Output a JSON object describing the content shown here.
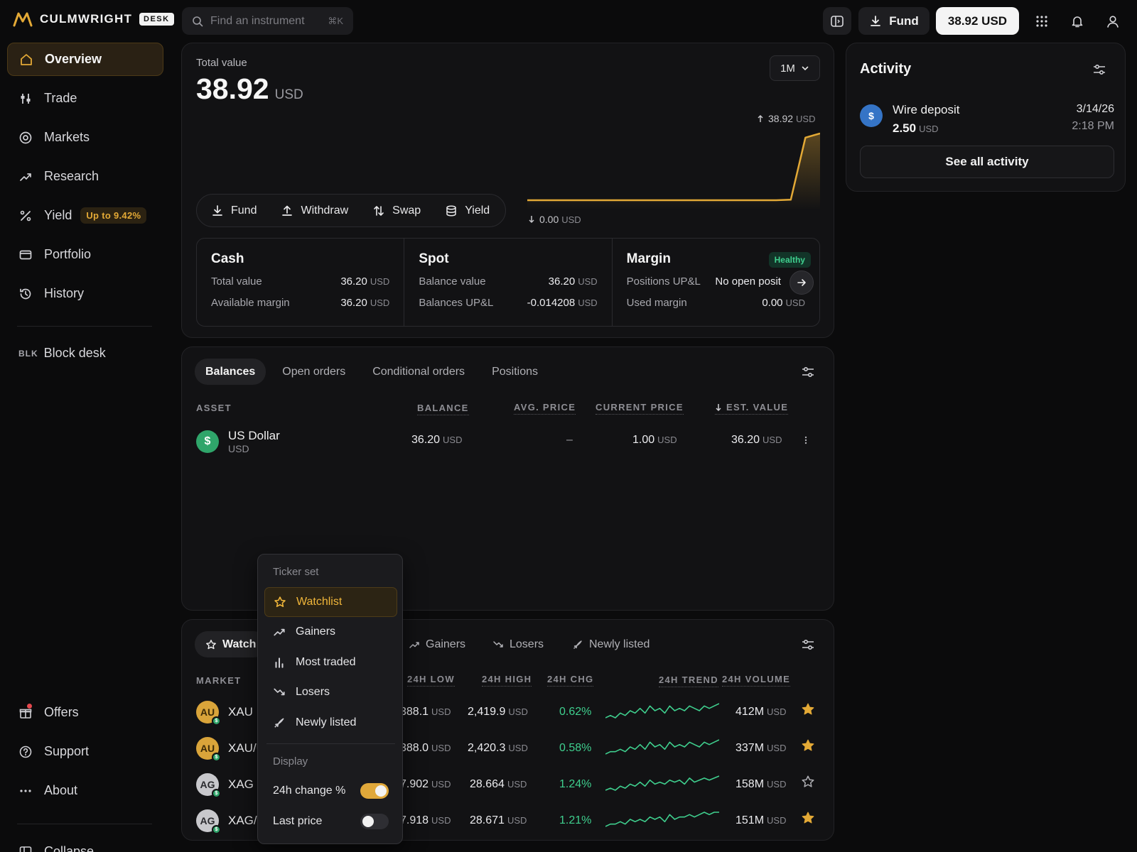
{
  "brand": {
    "name": "CULMWRIGHT",
    "badge": "DESK"
  },
  "header": {
    "search_placeholder": "Find an instrument",
    "search_shortcut": "⌘K",
    "fund_label": "Fund",
    "balance_label": "38.92 USD"
  },
  "sidebar": {
    "items": [
      {
        "label": "Overview",
        "icon": "home-icon",
        "active": true
      },
      {
        "label": "Trade",
        "icon": "sliders-icon"
      },
      {
        "label": "Markets",
        "icon": "target-icon"
      },
      {
        "label": "Research",
        "icon": "trend-up-icon"
      },
      {
        "label": "Yield",
        "icon": "percent-icon",
        "badge": "Up to 9.42%"
      },
      {
        "label": "Portfolio",
        "icon": "wallet-icon"
      },
      {
        "label": "History",
        "icon": "history-icon"
      }
    ],
    "block_desk": {
      "prefix": "BLK",
      "label": "Block desk"
    },
    "bottom": [
      {
        "label": "Offers",
        "icon": "gift-icon"
      },
      {
        "label": "Support",
        "icon": "help-icon"
      },
      {
        "label": "About",
        "icon": "more-icon"
      }
    ],
    "collapse_label": "Collapse"
  },
  "overview": {
    "total_label": "Total value",
    "total_amount": "38.92",
    "total_unit": "USD",
    "period": "1M",
    "chart_high": "38.92",
    "chart_low": "0.00",
    "chart_unit": "USD",
    "chart_trend": [
      0,
      0,
      0,
      0,
      0,
      0,
      0,
      0,
      0,
      0,
      0,
      0,
      0,
      0,
      0,
      0,
      0,
      0,
      0.3,
      36.5,
      38.92
    ],
    "actions": [
      "Fund",
      "Withdraw",
      "Swap",
      "Yield"
    ],
    "cards": {
      "cash": {
        "title": "Cash",
        "rows": [
          {
            "k": "Total value",
            "v": "36.20",
            "u": "USD"
          },
          {
            "k": "Available margin",
            "v": "36.20",
            "u": "USD"
          }
        ]
      },
      "spot": {
        "title": "Spot",
        "rows": [
          {
            "k": "Balance value",
            "v": "36.20",
            "u": "USD"
          },
          {
            "k": "Balances UP&L",
            "v": "-0.014208",
            "u": "USD"
          }
        ]
      },
      "margin": {
        "title": "Margin",
        "status": "Healthy",
        "rows": [
          {
            "k": "Positions UP&L",
            "v": "No open posit"
          },
          {
            "k": "Used margin",
            "v": "0.00",
            "u": "USD"
          }
        ]
      }
    }
  },
  "balances": {
    "tabs": [
      "Balances",
      "Open orders",
      "Conditional orders",
      "Positions"
    ],
    "columns": [
      "ASSET",
      "BALANCE",
      "AVG. PRICE",
      "CURRENT PRICE",
      "EST. VALUE"
    ],
    "rows": [
      {
        "name": "US Dollar",
        "ticker": "USD",
        "balance": "36.20",
        "avg": "–",
        "current": "1.00",
        "est": "36.20",
        "unit": "USD"
      }
    ]
  },
  "watchlist": {
    "tabs": [
      "Watch",
      "Gainers",
      "Losers",
      "Newly listed"
    ],
    "columns": [
      "MARKET",
      "24H LOW",
      "24H HIGH",
      "24H CHG",
      "24H TREND",
      "24H VOLUME"
    ],
    "rows": [
      {
        "coin": "AU",
        "market": "XAU I",
        "low": "388.1",
        "high": "2,419.9",
        "chg": "0.62%",
        "vol": "412M",
        "starred": true,
        "trend": [
          3,
          4,
          3,
          5,
          4,
          6,
          5,
          7,
          5,
          8,
          6,
          7,
          5,
          8,
          6,
          7,
          6,
          8,
          7,
          6,
          8,
          7,
          8,
          9
        ]
      },
      {
        "coin": "AU",
        "market": "XAU/U",
        "low": "388.0",
        "high": "2,420.3",
        "chg": "0.58%",
        "vol": "337M",
        "starred": true,
        "trend": [
          2,
          3,
          3,
          4,
          3,
          5,
          4,
          6,
          4,
          7,
          5,
          6,
          4,
          7,
          5,
          6,
          5,
          7,
          6,
          5,
          7,
          6,
          7,
          8
        ]
      },
      {
        "coin": "AG",
        "market": "XAG I",
        "low": "7.902",
        "high": "28.664",
        "chg": "1.24%",
        "vol": "158M",
        "starred": false,
        "trend": [
          2,
          3,
          2,
          4,
          3,
          5,
          4,
          6,
          4,
          7,
          5,
          6,
          5,
          7,
          6,
          7,
          5,
          8,
          6,
          7,
          8,
          7,
          8,
          9
        ]
      },
      {
        "coin": "AG",
        "market": "XAG/U",
        "low": "7.918",
        "high": "28.671",
        "chg": "1.21%",
        "vol": "151M",
        "starred": true,
        "trend": [
          2,
          3,
          3,
          4,
          3,
          5,
          4,
          5,
          4,
          6,
          5,
          6,
          4,
          7,
          5,
          6,
          6,
          7,
          6,
          7,
          8,
          7,
          8,
          8
        ]
      }
    ],
    "unit": "USD"
  },
  "dropdown": {
    "section1": "Ticker set",
    "items": [
      {
        "label": "Watchlist",
        "icon": "star-icon",
        "selected": true
      },
      {
        "label": "Gainers",
        "icon": "trend-up-icon"
      },
      {
        "label": "Most traded",
        "icon": "bar-chart-icon"
      },
      {
        "label": "Losers",
        "icon": "trend-down-icon"
      },
      {
        "label": "Newly listed",
        "icon": "rocket-icon"
      }
    ],
    "section2": "Display",
    "toggles": [
      {
        "label": "24h change %",
        "on": true
      },
      {
        "label": "Last price",
        "on": false
      }
    ]
  },
  "activity": {
    "title": "Activity",
    "item": {
      "title": "Wire deposit",
      "amount": "2.50",
      "unit": "USD",
      "date": "3/14/26",
      "time": "2:18 PM"
    },
    "see_all": "See all activity"
  },
  "colors": {
    "accent": "#e3a936",
    "positive": "#3fcf8e",
    "usd_coin": "#2fa56a",
    "activity_coin": "#3574c6"
  }
}
